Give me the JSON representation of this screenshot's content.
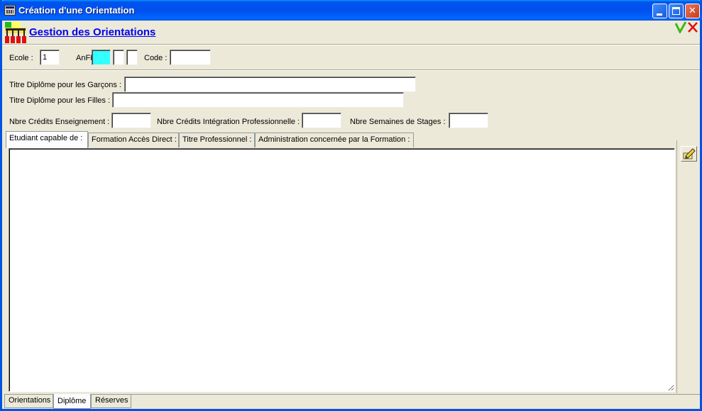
{
  "window": {
    "title": "Création d'une Orientation",
    "controls": [
      "minimize-icon",
      "maximize-icon",
      "close-icon"
    ]
  },
  "header": {
    "title": "Gestion des Orientations",
    "icons": [
      "app-logo-icon",
      "validate-check-icon",
      "cancel-x-icon"
    ]
  },
  "top_fields": {
    "ecole_label": "Ecole :",
    "ecole_value": "1",
    "anff_label": "AnFF :",
    "anff_values": [
      "",
      "",
      ""
    ],
    "code_label": "Code :",
    "code_value": ""
  },
  "diplome": {
    "titre_garcons_label": "Titre Diplôme pour les Garçons :",
    "titre_garcons_value": "",
    "titre_filles_label": "Titre Diplôme pour les Filles :",
    "titre_filles_value": "",
    "credits_enseignement_label": "Nbre Crédits Enseignement :",
    "credits_enseignement_value": "",
    "credits_integration_label": "Nbre Crédits Intégration Professionnelle :",
    "credits_integration_value": "",
    "semaines_stages_label": "Nbre Semaines de Stages :",
    "semaines_stages_value": ""
  },
  "inner_tabs": [
    {
      "label": "Etudiant capable de :",
      "active": true
    },
    {
      "label": "Formation Accès Direct :",
      "active": false
    },
    {
      "label": "Titre Professionnel :",
      "active": false
    },
    {
      "label": "Administration concernée par la Formation :",
      "active": false
    }
  ],
  "content": {
    "text": ""
  },
  "side_tools": {
    "icon": "edit-pencil-icon"
  },
  "bottom_tabs": [
    {
      "label": "Orientations",
      "active": false
    },
    {
      "label": "Diplôme",
      "active": true
    },
    {
      "label": "Réserves",
      "active": false
    }
  ],
  "colors": {
    "titlebar": "#0054e3",
    "window_bg": "#ece9d8",
    "link_title": "#0000ee",
    "anff_highlight": "#33ffff",
    "ok_green": "#3cb815",
    "cancel_red": "#e01010"
  }
}
